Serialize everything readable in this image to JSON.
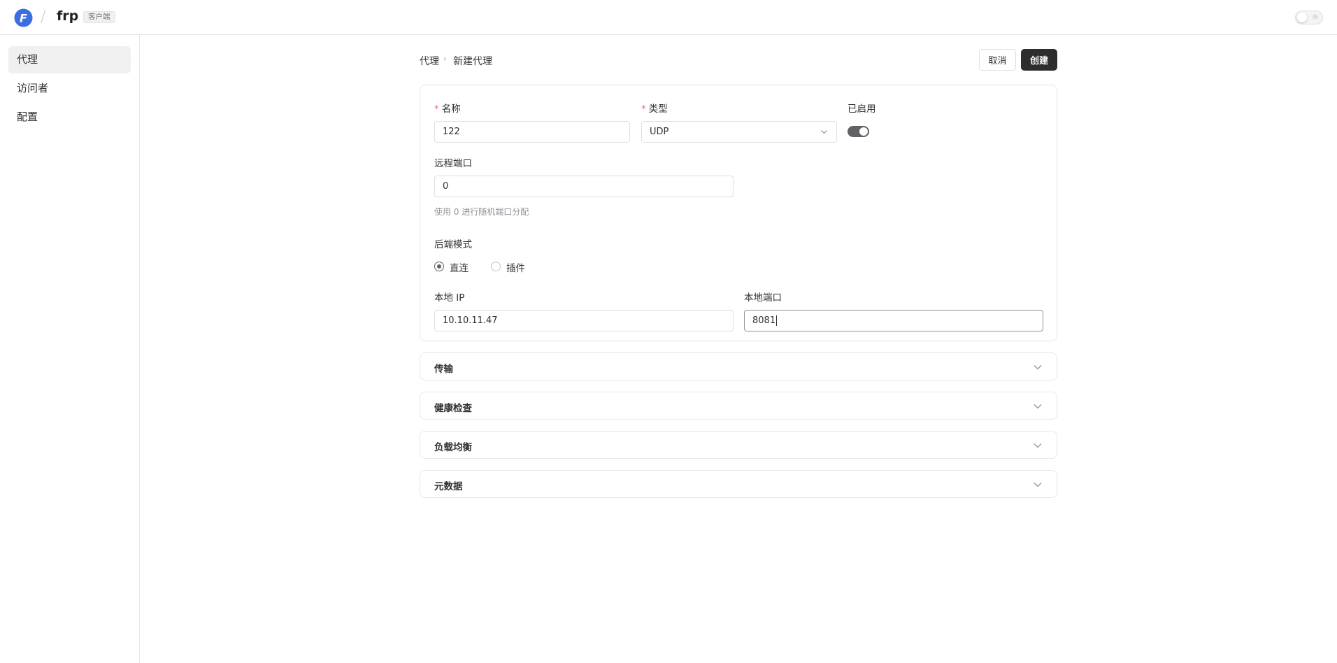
{
  "topbar": {
    "logo_letter": "F",
    "slash": "/",
    "brand": "frp",
    "badge": "客户端",
    "theme_icon": "sun-icon"
  },
  "sidebar": {
    "items": [
      {
        "label": "代理",
        "active": true
      },
      {
        "label": "访问者",
        "active": false
      },
      {
        "label": "配置",
        "active": false
      }
    ]
  },
  "breadcrumb": {
    "parent": "代理",
    "separator": "›",
    "current": "新建代理"
  },
  "actions": {
    "cancel_label": "取消",
    "create_label": "创建"
  },
  "form": {
    "name": {
      "label": "名称",
      "value": "122",
      "required_mark": "*"
    },
    "type": {
      "label": "类型",
      "value": "UDP",
      "required_mark": "*"
    },
    "enabled": {
      "label": "已启用",
      "on": true
    },
    "remote_port": {
      "label": "远程端口",
      "value": "0",
      "hint": "使用 0 进行随机端口分配"
    },
    "backend_mode": {
      "label": "后端模式",
      "options": [
        {
          "label": "直连",
          "checked": true
        },
        {
          "label": "插件",
          "checked": false
        }
      ]
    },
    "local_ip": {
      "label": "本地 IP",
      "value": "10.10.11.47"
    },
    "local_port": {
      "label": "本地端口",
      "value": "8081"
    }
  },
  "sections": [
    {
      "title": "传输"
    },
    {
      "title": "健康检查"
    },
    {
      "title": "负载均衡"
    },
    {
      "title": "元数据"
    }
  ],
  "colors": {
    "primary_button": "#2d2d2d",
    "required": "#f56c6c",
    "logo": "#3b6fe0"
  }
}
